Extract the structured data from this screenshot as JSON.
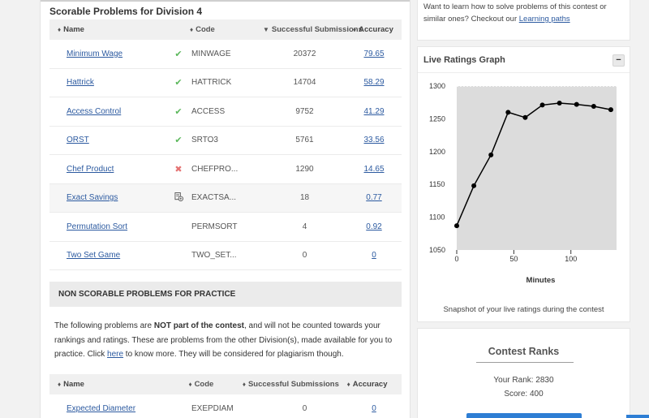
{
  "scorable": {
    "title": "Scorable Problems for Division 4",
    "headers": {
      "name": "Name",
      "code": "Code",
      "successful": "Successful Submissions",
      "accuracy": "Accuracy"
    },
    "rows": [
      {
        "name": "Minimum Wage",
        "status": "solved",
        "code": "MINWAGE",
        "successful": "20372",
        "accuracy": "79.65"
      },
      {
        "name": "Hattrick",
        "status": "solved",
        "code": "HATTRICK",
        "successful": "14704",
        "accuracy": "58.29"
      },
      {
        "name": "Access Control",
        "status": "solved",
        "code": "ACCESS",
        "successful": "9752",
        "accuracy": "41.29"
      },
      {
        "name": "ORST",
        "status": "solved",
        "code": "SRTO3",
        "successful": "5761",
        "accuracy": "33.56"
      },
      {
        "name": "Chef Product",
        "status": "wrong",
        "code": "CHEFPRO...",
        "successful": "1290",
        "accuracy": "14.65"
      },
      {
        "name": "Exact Savings",
        "status": "pending",
        "code": "EXACTSA...",
        "successful": "18",
        "accuracy": "0.77"
      },
      {
        "name": "Permutation Sort",
        "status": "none",
        "code": "PERMSORT",
        "successful": "4",
        "accuracy": "0.92"
      },
      {
        "name": "Two Set Game",
        "status": "none",
        "code": "TWO_SET...",
        "successful": "0",
        "accuracy": "0"
      }
    ]
  },
  "non_scorable": {
    "header": "NON SCORABLE PROBLEMS FOR PRACTICE",
    "text_1": "The following problems are ",
    "text_bold": "NOT part of the contest",
    "text_2": ", and will not be counted towards your rankings and ratings. These are problems from the other Division(s), made available for you to practice. Click ",
    "text_link": "here",
    "text_3": " to know more. They will be considered for plagiarism though.",
    "headers": {
      "name": "Name",
      "code": "Code",
      "successful": "Successful Submissions",
      "accuracy": "Accuracy"
    },
    "rows": [
      {
        "name": "Expected Diameter",
        "code": "EXEPDIAM",
        "successful": "0",
        "accuracy": "0"
      }
    ]
  },
  "learning": {
    "text": "Want to learn how to solve problems of this contest or similar ones? Checkout our ",
    "link": "Learning paths"
  },
  "graph_card": {
    "title": "Live Ratings Graph",
    "collapse": "−",
    "caption": "Snapshot of your live ratings during the contest"
  },
  "chart_data": {
    "type": "line",
    "title": "",
    "xlabel": "Minutes",
    "ylabel": "",
    "xlim": [
      0,
      140
    ],
    "ylim": [
      1050,
      1300
    ],
    "xticks": [
      0,
      50,
      100
    ],
    "yticks": [
      1050,
      1100,
      1150,
      1200,
      1250,
      1300
    ],
    "grid": false,
    "series": [
      {
        "x": [
          0,
          15,
          30,
          45,
          60,
          75,
          90,
          105,
          120,
          135
        ],
        "y": [
          1087,
          1148,
          1195,
          1260,
          1252,
          1271,
          1274,
          1272,
          1269,
          1264
        ]
      }
    ],
    "colors": {
      "plot_bg": "#dcdcdc",
      "line": "#000000"
    }
  },
  "ranks": {
    "title": "Contest Ranks",
    "rank": "Your Rank: 2830",
    "score": "Score: 400"
  }
}
